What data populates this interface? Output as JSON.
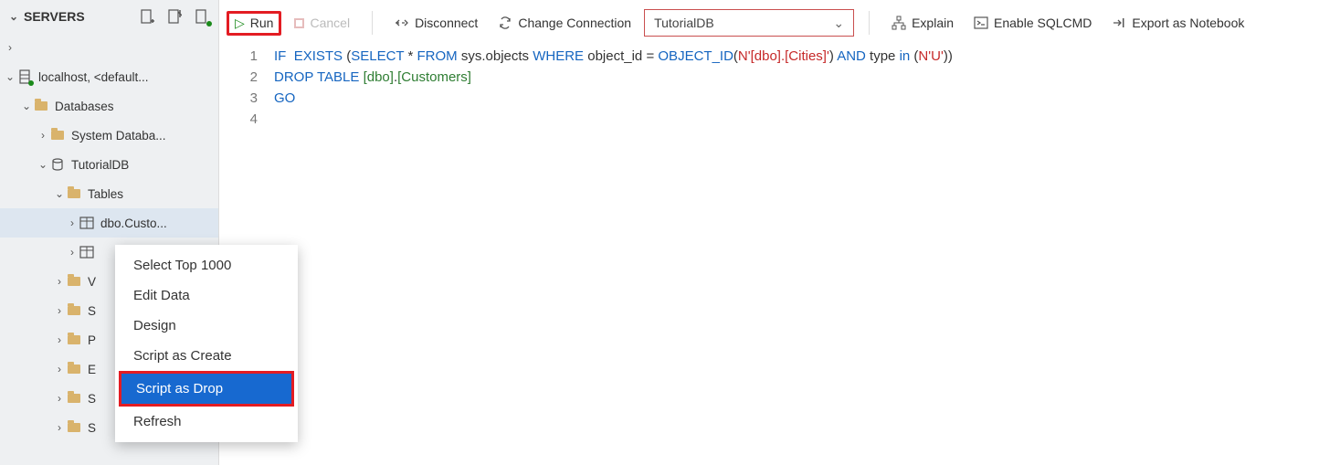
{
  "sidebar": {
    "title": "SERVERS",
    "root": "",
    "connection": "localhost, <default...",
    "databases_label": "Databases",
    "systemdb_label": "System Databa...",
    "tutdb_label": "TutorialDB",
    "tables_label": "Tables",
    "table_custo": "dbo.Custo...",
    "partial_v": "V",
    "partial_s1": "S",
    "partial_p": "P",
    "partial_e": "E",
    "partial_s2": "S",
    "partial_s3": "S"
  },
  "toolbar": {
    "run": "Run",
    "cancel": "Cancel",
    "disconnect": "Disconnect",
    "change_conn": "Change Connection",
    "db_select": "TutorialDB",
    "explain": "Explain",
    "enable_sqlcmd": "Enable SQLCMD",
    "export_nb": "Export as Notebook"
  },
  "editor": {
    "lines": [
      "1",
      "2",
      "3",
      "4"
    ]
  },
  "sql": {
    "if": "IF",
    "exists": "EXISTS",
    "select": "SELECT",
    "star": "*",
    "from": "FROM",
    "sysobj": "sys.objects",
    "where": "WHERE",
    "objid": "object_id",
    "eq": "=",
    "objfn": "OBJECT_ID",
    "n1": "N'[dbo].[Cities]'",
    "and": "AND",
    "type": "type",
    "in": "in",
    "n2": "N'U'",
    "drop": "DROP",
    "table": "TABLE",
    "dbo": "[dbo]",
    "dot": ".",
    "cust": "[Customers]",
    "go": "GO"
  },
  "context_menu": {
    "items": [
      "Select Top 1000",
      "Edit Data",
      "Design",
      "Script as Create",
      "Script as Drop",
      "Refresh"
    ]
  }
}
